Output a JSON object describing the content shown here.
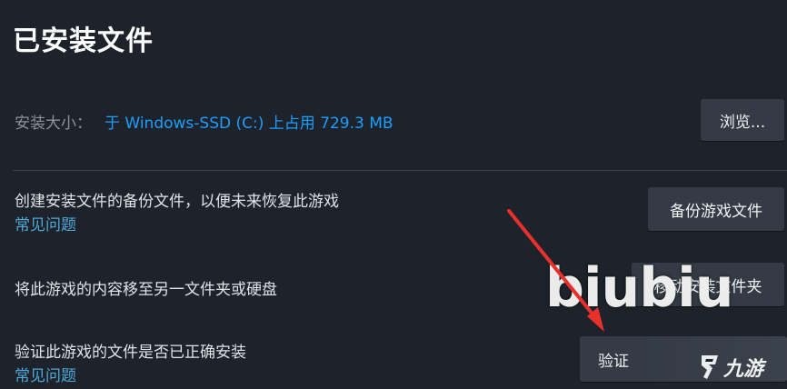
{
  "page": {
    "title": "已安装文件"
  },
  "install_size": {
    "label": "安装大小：",
    "value": "于 Windows-SSD (C:) 上占用 729.3 MB"
  },
  "buttons": {
    "browse": "浏览...",
    "backup": "备份游戏文件",
    "move": "移动安装文件夹",
    "verify": "验证"
  },
  "rows": {
    "backup": {
      "text": "创建安装文件的备份文件，以便未来恢复此游戏",
      "faq": "常见问题"
    },
    "move": {
      "text": "将此游戏的内容移至另一文件夹或硬盘"
    },
    "verify": {
      "text": "验证此游戏的文件是否已正确安装",
      "faq": "常见问题"
    }
  },
  "watermark": {
    "text": "biubiu"
  },
  "logo": {
    "text": "九游",
    "icon": "nine-game-logo-icon"
  },
  "annotation": {
    "icon": "red-arrow-icon",
    "color": "#e8302c"
  },
  "colors": {
    "background": "#1e232b",
    "link": "#1a9fff",
    "faq": "#4fa8d8",
    "button": "#343b45"
  }
}
